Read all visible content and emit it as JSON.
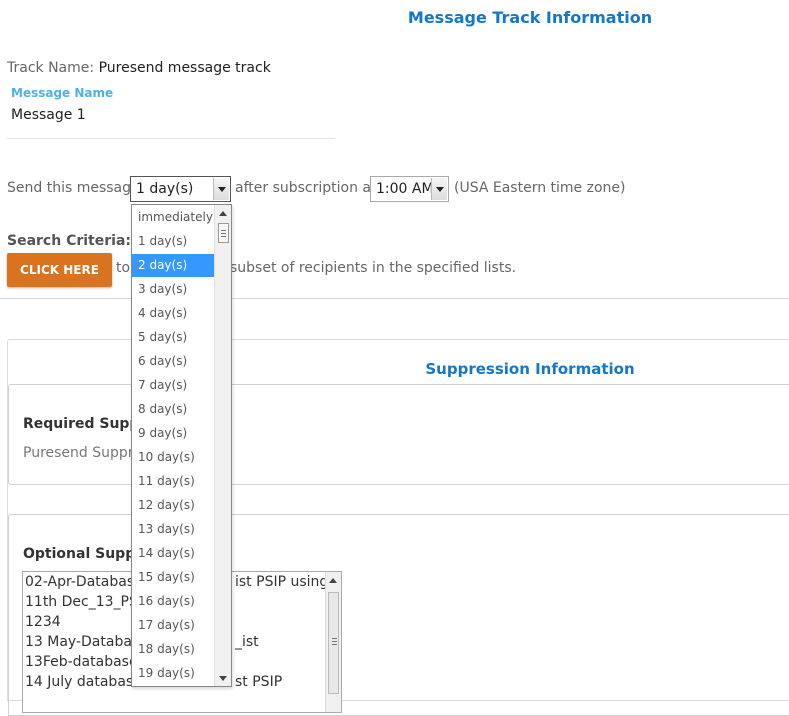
{
  "header": {
    "title": "Message Track Information"
  },
  "track": {
    "label": "Track Name:",
    "value": "Puresend message track"
  },
  "message": {
    "name_label": "Message Name",
    "name_value": "Message 1"
  },
  "schedule": {
    "prefix": "Send this message",
    "days_value": "1 day(s)",
    "middle": "after subscription at",
    "time_value": "1:00 AM",
    "suffix": "(USA Eastern time zone)",
    "options": [
      "immediately",
      "1 day(s)",
      "2 day(s)",
      "3 day(s)",
      "4 day(s)",
      "5 day(s)",
      "6 day(s)",
      "7 day(s)",
      "8 day(s)",
      "9 day(s)",
      "10 day(s)",
      "11 day(s)",
      "12 day(s)",
      "13 day(s)",
      "14 day(s)",
      "15 day(s)",
      "16 day(s)",
      "17 day(s)",
      "18 day(s)",
      "19 day(s)"
    ],
    "highlighted": "2 day(s)"
  },
  "search": {
    "label": "Search Criteria:",
    "button": "CLICK HERE",
    "text_left": "to",
    "text_right": "subset of recipients in the specified lists."
  },
  "suppression": {
    "title": "Suppression Information",
    "required_label": "Required Suppre",
    "required_value": "Puresend Suppre",
    "optional_label": "Optional Suppre",
    "list_items": [
      [
        "02-Apr-Database",
        "ist PSIP using V"
      ],
      [
        "11th Dec_13_PSI",
        ""
      ],
      [
        "1234",
        ""
      ],
      [
        "13 May-Database",
        "_ist"
      ],
      [
        "13Feb-database",
        ""
      ],
      [
        "14 July database",
        "st PSIP"
      ]
    ]
  },
  "colors": {
    "accent": "#1478c8",
    "button": "#d9731f",
    "highlight": "#3399ff",
    "light_label": "#4fb1e6"
  }
}
